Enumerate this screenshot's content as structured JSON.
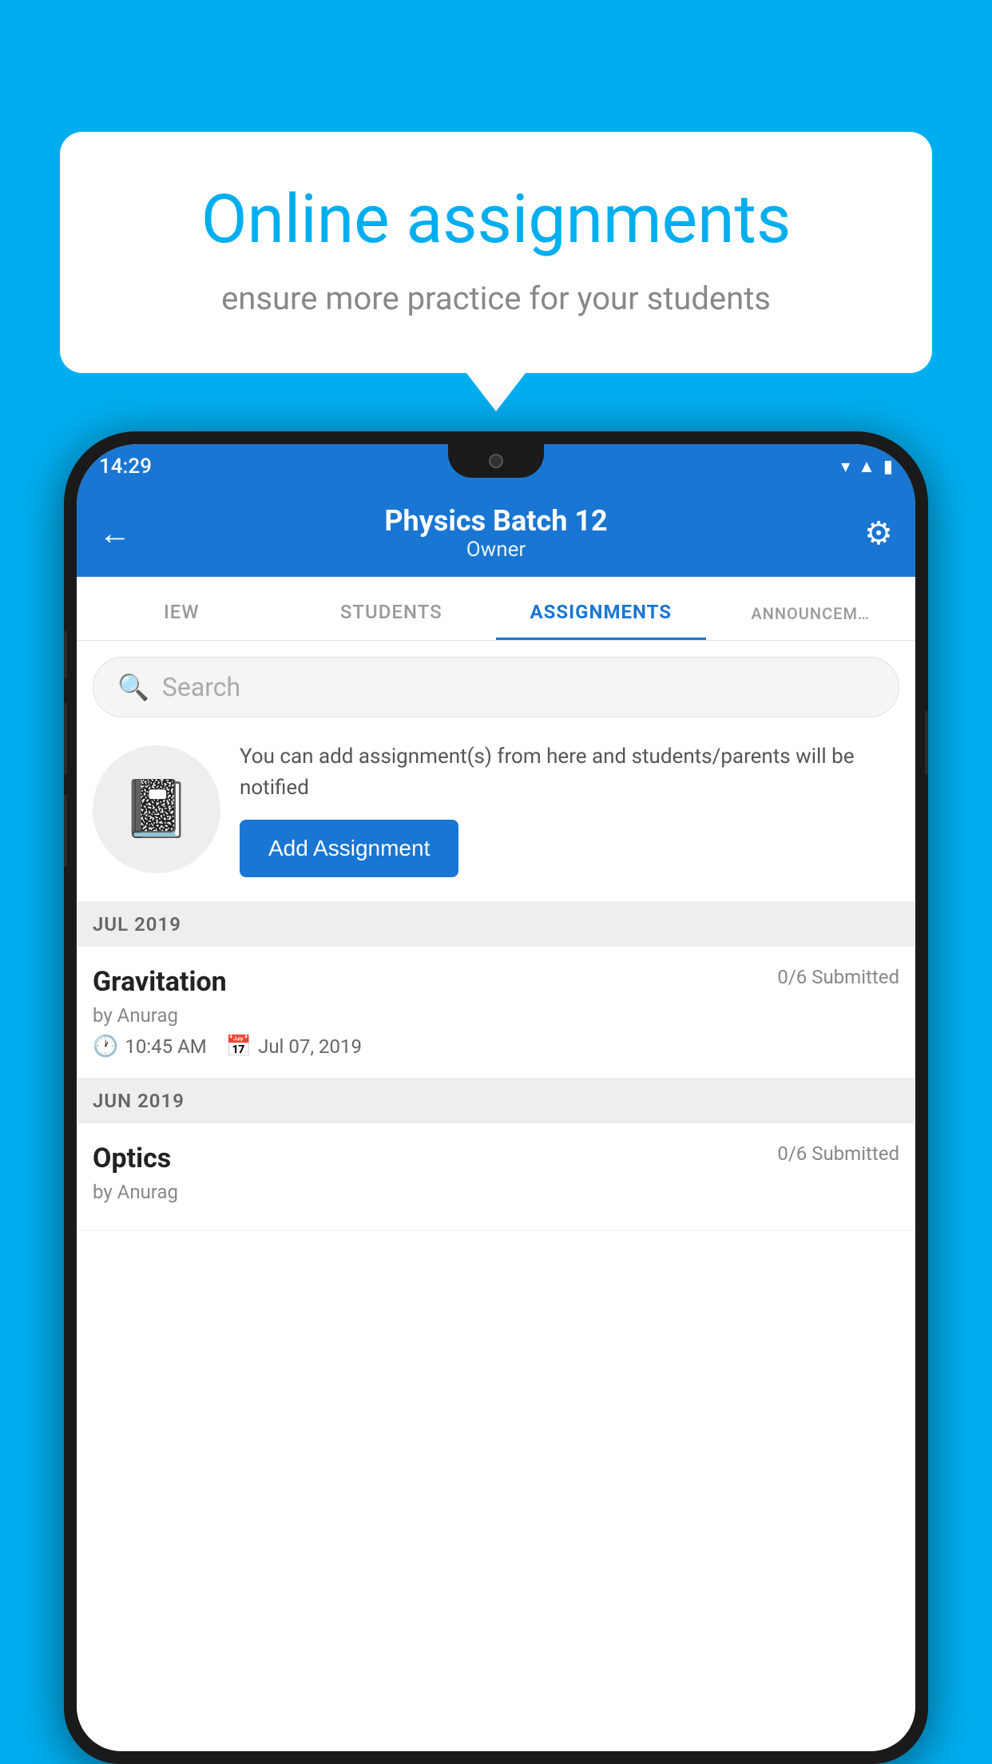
{
  "promo": {
    "title": "Online assignments",
    "subtitle": "ensure more practice for your students"
  },
  "phone": {
    "status_bar": {
      "time": "14:29"
    },
    "header": {
      "title": "Physics Batch 12",
      "subtitle": "Owner",
      "back_label": "←",
      "settings_label": "⚙"
    },
    "tabs": [
      {
        "label": "IEW",
        "active": false
      },
      {
        "label": "STUDENTS",
        "active": false
      },
      {
        "label": "ASSIGNMENTS",
        "active": true
      },
      {
        "label": "ANNOUNCEM…",
        "active": false
      }
    ],
    "search": {
      "placeholder": "Search"
    },
    "add_promo": {
      "description": "You can add assignment(s) from here and students/parents will be notified",
      "button_label": "Add Assignment"
    },
    "sections": [
      {
        "label": "JUL 2019",
        "assignments": [
          {
            "name": "Gravitation",
            "submitted": "0/6 Submitted",
            "by": "by Anurag",
            "time": "10:45 AM",
            "date": "Jul 07, 2019"
          }
        ]
      },
      {
        "label": "JUN 2019",
        "assignments": [
          {
            "name": "Optics",
            "submitted": "0/6 Submitted",
            "by": "by Anurag",
            "time": "",
            "date": ""
          }
        ]
      }
    ]
  }
}
